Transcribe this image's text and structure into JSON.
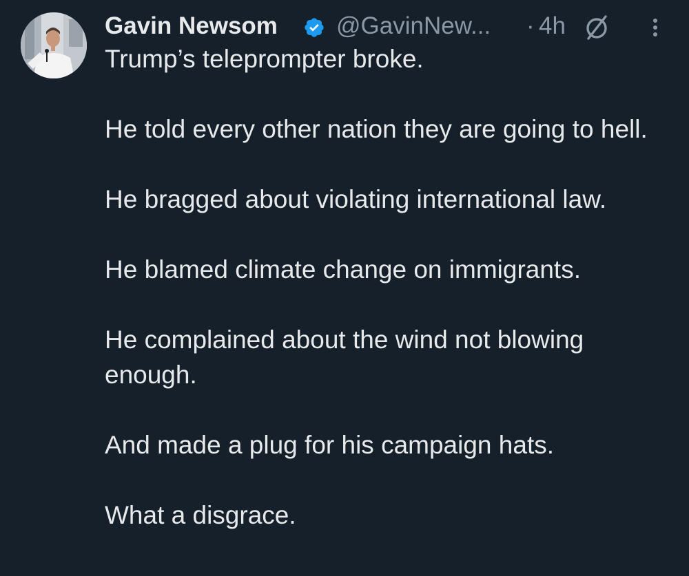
{
  "tweet": {
    "author": {
      "display_name": "Gavin Newsom",
      "handle": "@GavinNew...",
      "verified": true
    },
    "separator": "·",
    "time": "4h",
    "paragraphs": [
      "Trump’s teleprompter broke.",
      "He told every other nation they are going to hell.",
      "He bragged about violating international law.",
      "He blamed climate change on immigrants.",
      "He complained about the wind not blowing enough.",
      "And made a plug for his campaign hats.",
      "What a disgrace."
    ]
  },
  "icons": {
    "verified": "verified-badge-icon",
    "grok": "grok-icon",
    "more": "more-options-icon"
  },
  "colors": {
    "background": "#15202b",
    "primary_text": "#e7e9ea",
    "secondary_text": "#8b98a5",
    "verified_blue": "#1d9bf0"
  }
}
